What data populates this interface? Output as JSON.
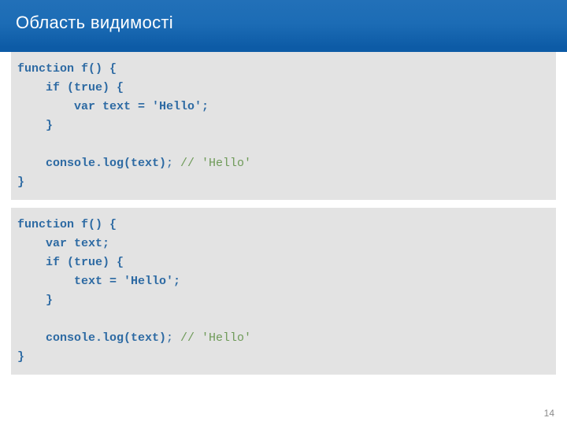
{
  "title": "Область видимості",
  "code1": {
    "l1": "function f() {",
    "l2": "    if (true) {",
    "l3": "        var text = 'Hello';",
    "l4": "    }",
    "l5": "",
    "l6a": "    console.log(text)",
    "l6b": "; ",
    "l6c": "// 'Hello'",
    "l7": "}"
  },
  "code2": {
    "l1": "function f() {",
    "l2": "    var text;",
    "l3": "    if (true) {",
    "l4": "        text = 'Hello';",
    "l5": "    }",
    "l6": "",
    "l7a": "    console.log(text)",
    "l7b": "; ",
    "l7c": "// 'Hello'",
    "l8": "}"
  },
  "page_number": "14"
}
